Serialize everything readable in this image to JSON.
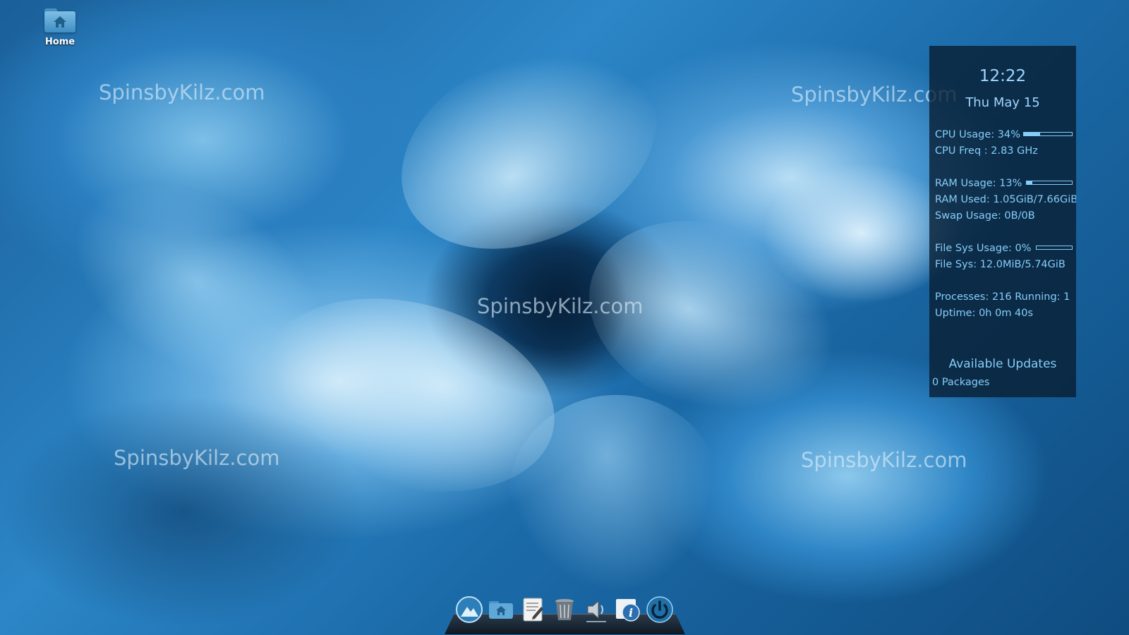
{
  "desktop": {
    "icons": [
      {
        "label": "Home",
        "icon": "home-folder-icon"
      }
    ],
    "watermark_text": "SpinsbyKilz.com"
  },
  "conky": {
    "time": "12:22",
    "date": "Thu May 15",
    "cpu_usage": "CPU Usage: 34%",
    "cpu_usage_percent": 34,
    "cpu_freq": "CPU Freq : 2.83 GHz",
    "ram_usage": "RAM Usage: 13%",
    "ram_usage_percent": 13,
    "ram_used": "RAM Used: 1.05GiB/7.66GiB",
    "swap_usage": "Swap Usage: 0B/0B",
    "fs_usage": "File Sys Usage:  0%",
    "fs_usage_percent": 0,
    "fs": "File Sys: 12.0MiB/5.74GiB",
    "processes": "Processes: 216   Running: 1",
    "uptime": "Uptime: 0h 0m 40s",
    "updates_title": "Available Updates",
    "updates_value": "0 Packages"
  },
  "dock": {
    "items": [
      {
        "name": "app-launcher-icon"
      },
      {
        "name": "home-folder-icon"
      },
      {
        "name": "text-editor-icon"
      },
      {
        "name": "trash-icon"
      },
      {
        "name": "volume-icon"
      },
      {
        "name": "system-info-icon"
      },
      {
        "name": "power-icon"
      }
    ]
  },
  "colors": {
    "conky_text": "#86cdf8",
    "conky_bg": "#081c30",
    "wallpaper_accent": "#2c86c7"
  }
}
